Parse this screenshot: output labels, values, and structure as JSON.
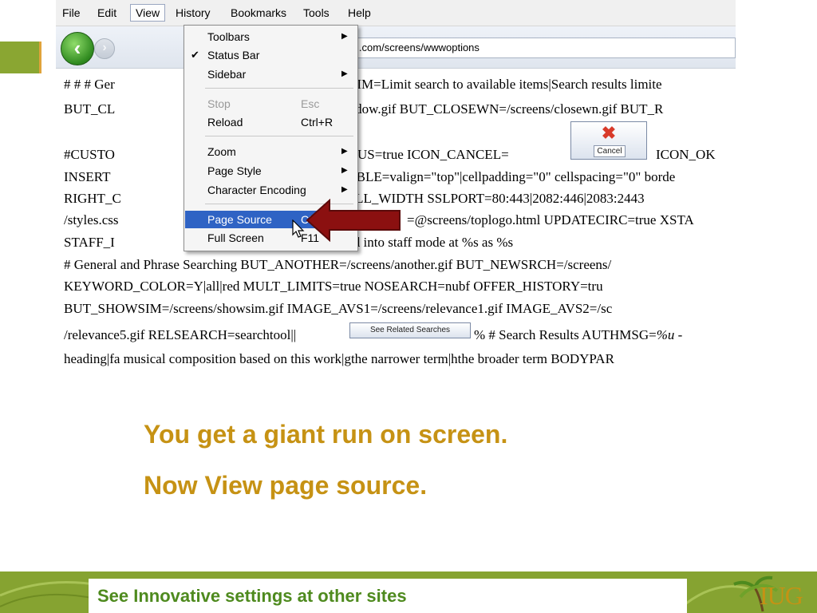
{
  "menubar": {
    "items": [
      {
        "label": "File"
      },
      {
        "label": "Edit"
      },
      {
        "label": "View"
      },
      {
        "label": "History"
      },
      {
        "label": "Bookmarks"
      },
      {
        "label": "Tools"
      },
      {
        "label": "Help"
      }
    ],
    "active": "View"
  },
  "toolbar": {
    "back_icon": "back-arrow-icon",
    "forward_icon": "forward-arrow-icon",
    "url": "http://csul.iii.com/screens/wwwoptions"
  },
  "view_menu": {
    "items": [
      {
        "label": "Toolbars",
        "shortcut": "",
        "submenu": true,
        "checked": false,
        "disabled": false
      },
      {
        "label": "Status Bar",
        "shortcut": "",
        "submenu": false,
        "checked": true,
        "disabled": false
      },
      {
        "label": "Sidebar",
        "shortcut": "",
        "submenu": true,
        "checked": false,
        "disabled": false
      },
      {
        "label": "Stop",
        "shortcut": "Esc",
        "submenu": false,
        "checked": false,
        "disabled": true
      },
      {
        "label": "Reload",
        "shortcut": "Ctrl+R",
        "submenu": false,
        "checked": false,
        "disabled": false
      },
      {
        "label": "Zoom",
        "shortcut": "",
        "submenu": true,
        "checked": false,
        "disabled": false
      },
      {
        "label": "Page Style",
        "shortcut": "",
        "submenu": true,
        "checked": false,
        "disabled": false
      },
      {
        "label": "Character Encoding",
        "shortcut": "",
        "submenu": true,
        "checked": false,
        "disabled": false
      },
      {
        "label": "Page Source",
        "shortcut": "Ctrl+U",
        "submenu": false,
        "checked": false,
        "disabled": false,
        "highlighted": true
      },
      {
        "label": "Full Screen",
        "shortcut": "F11",
        "submenu": false,
        "checked": false,
        "disabled": false
      }
    ]
  },
  "page_text": {
    "lines": [
      "# # # Ger",
      "BUT_CL",
      "",
      "#CUSTO",
      "INSERT",
      "RIGHT_C",
      "/styles.css",
      "STAFF_I",
      "# General and Phrase Searching BUT_ANOTHER=/screens/another.gif BUT_NEWSRCH=/screens/",
      "KEYWORD_COLOR=Y|all|red MULT_LIMITS=true NOSEARCH=nubf OFFER_HISTORY=tru",
      "BUT_SHOWSIM=/screens/showsim.gif IMAGE_AVS1=/screens/relevance1.gif IMAGE_AVS2=/sc",
      "/relevance5.gif RELSEARCH=searchtool||",
      "heading|fa musical composition based on this work|gthe narrower term|hthe broader term BODYPAR"
    ],
    "right_fragments": [
      "#AVAILLIM=Limit search to available items|Search results limite",
      "/closewindow.gif BUT_CLOSEWN=/screens/closewn.gif BUT_R",
      "RM_FOCUS=true ICON_CANCEL=",
      "ICON_OK",
      "URCETABLE=valign=\"top\"|cellpadding=\"0\" cellspacing=\"0\" borde",
      "GHT_CELL_WIDTH SSLPORT=80:443|2082:446|2083:2443",
      "=@screens/toplogo.html UPDATECIRC=true XSTA",
      "are logged into staff mode at %s as %s"
    ],
    "fragment_t": "T",
    "after_related_a": "% # Search Results AUTHMSG=",
    "after_related_b": "%u",
    "after_related_c": " -",
    "cancel_button_label": "Cancel",
    "related_button_label": "See Related Searches"
  },
  "captions": {
    "line1": "You get a giant run on screen.",
    "line2": "Now View page source."
  },
  "footer": {
    "text": "See Innovative settings at other sites",
    "logo_text": "IUG"
  },
  "colors": {
    "caption": "#c69214",
    "footer_green": "#86a331",
    "footer_text": "#4e8a1e",
    "arrow_red": "#8b1010",
    "menu_highlight": "#2f63c4"
  }
}
